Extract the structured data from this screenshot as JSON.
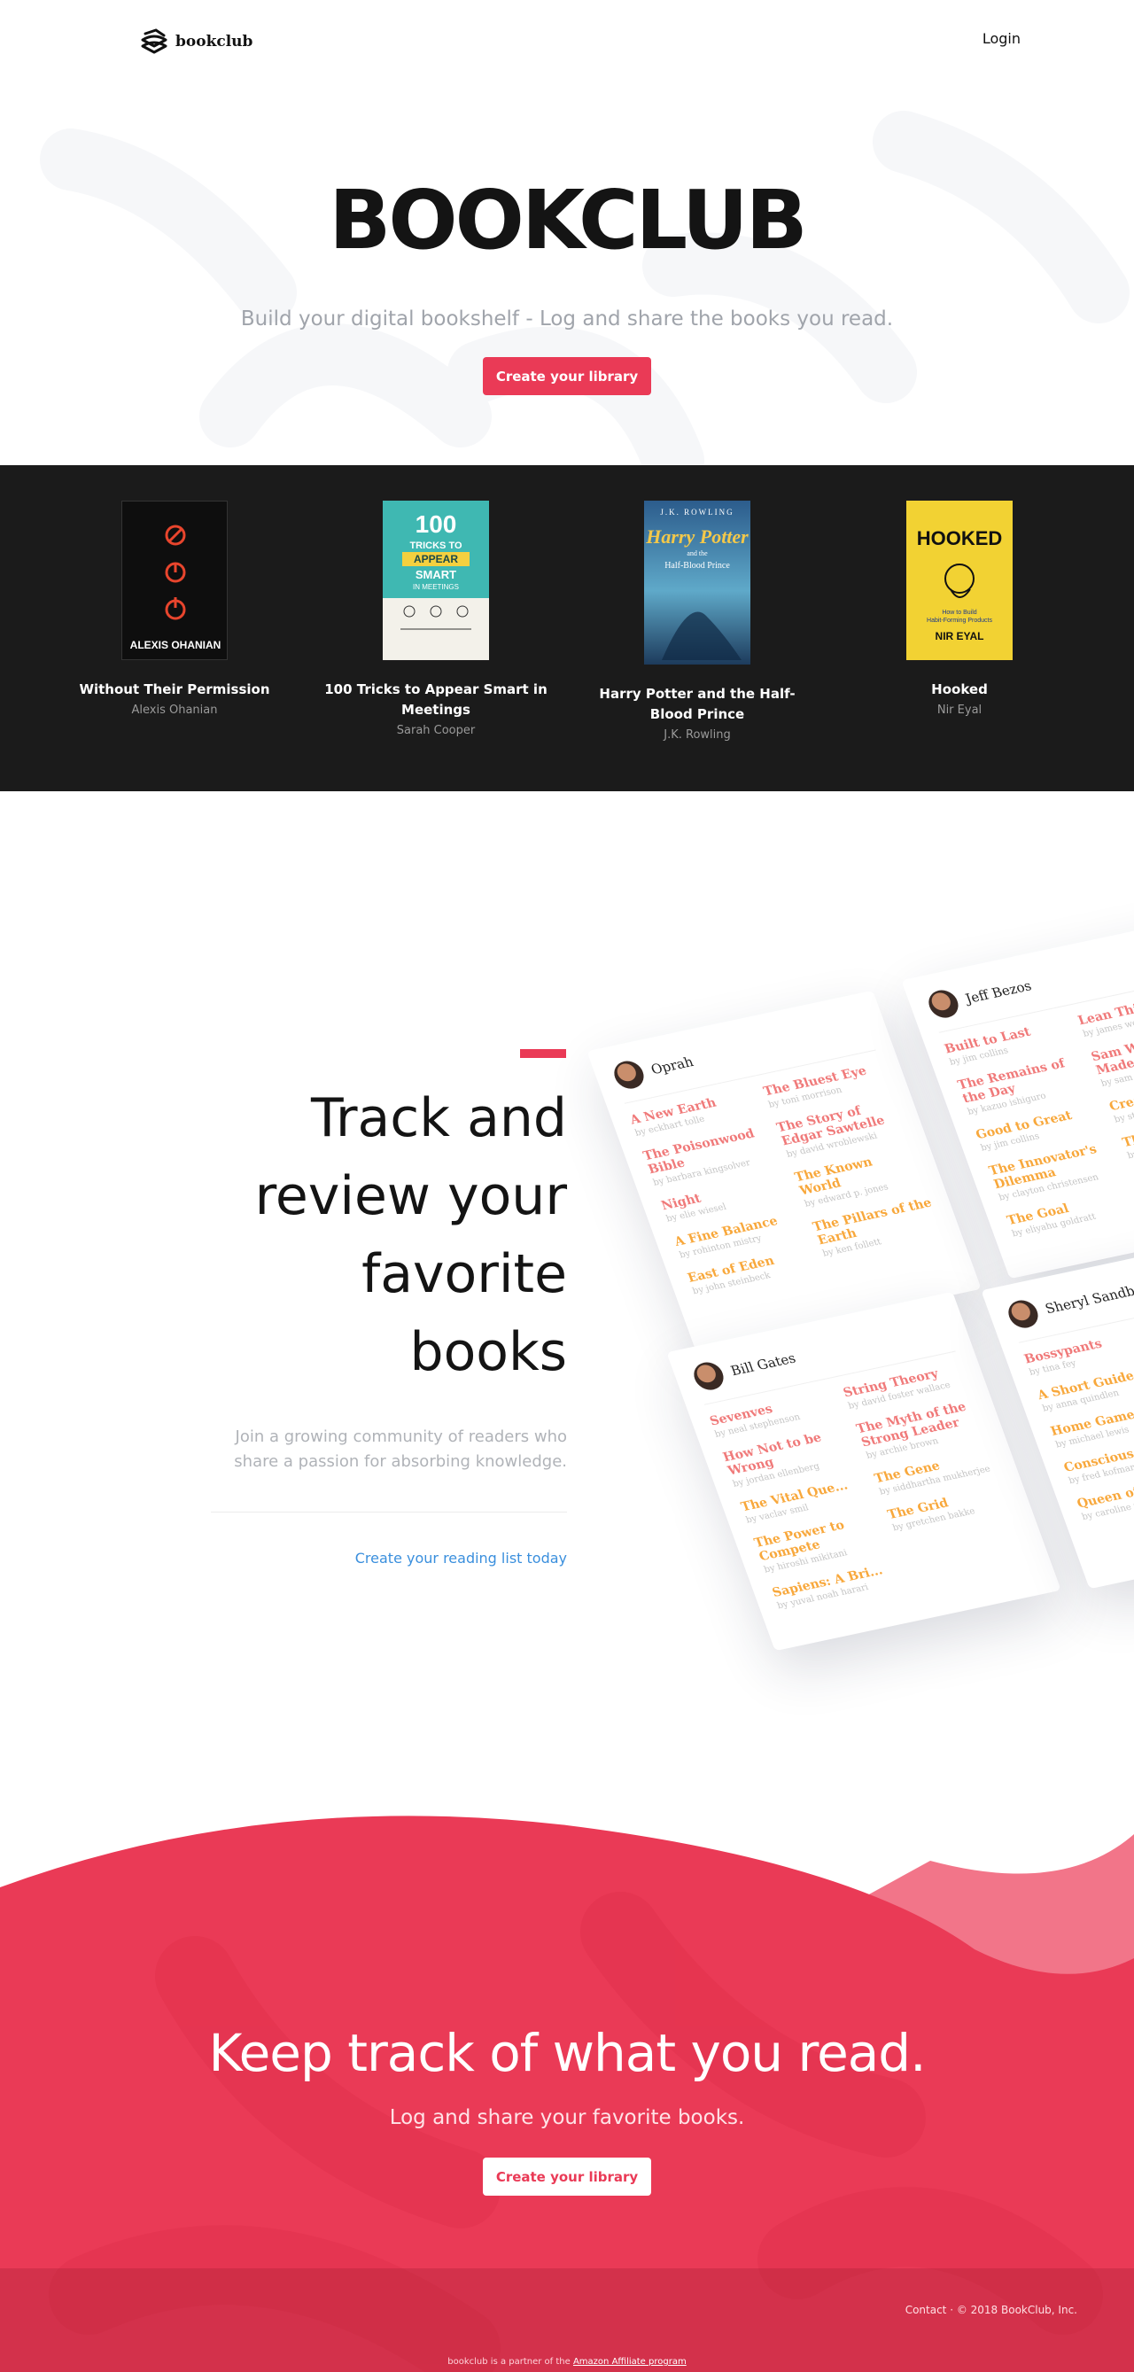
{
  "nav": {
    "brand": "bookclub",
    "login": "Login"
  },
  "hero": {
    "title": "BOOKCLUB",
    "subtitle": "Build your digital bookshelf - Log and share the books you read.",
    "cta": "Create your library"
  },
  "books": [
    {
      "title": "Without Their Permission",
      "author": "Alexis Ohanian",
      "cover_text": "ALEXIS OHANIAN"
    },
    {
      "title": "100 Tricks to Appear Smart in Meetings",
      "author": "Sarah Cooper",
      "cover_text": "100 TRICKS TO APPEAR SMART IN MEETINGS"
    },
    {
      "title": "Harry Potter and the Half-Blood Prince",
      "author": "J.K. Rowling",
      "cover_text": "J.K. ROWLING"
    },
    {
      "title": "Hooked",
      "author": "Nir Eyal",
      "cover_text": "HOOKED"
    }
  ],
  "feature": {
    "title": "Track and review your favorite books",
    "subtitle": "Join a growing community of readers who share a passion for absorbing knowledge.",
    "link": "Create your reading list today"
  },
  "cards": [
    {
      "name": "Oprah",
      "left": [
        [
          "A New Earth",
          "by eckhart tolle"
        ],
        [
          "The Poisonwood Bible",
          "by barbara kingsolver"
        ],
        [
          "Night",
          "by elie wiesel"
        ],
        [
          "A Fine Balance",
          "by rohinton mistry"
        ],
        [
          "East of Eden",
          "by john steinbeck"
        ]
      ],
      "right": [
        [
          "The Bluest Eye",
          "by toni morrison"
        ],
        [
          "The Story of Edgar Sawtelle",
          "by david wroblewski"
        ],
        [
          "The Known World",
          "by edward p. jones"
        ],
        [
          "The Pillars of the Earth",
          "by ken follett"
        ]
      ]
    },
    {
      "name": "Jeff Bezos",
      "left": [
        [
          "Built to Last",
          "by jim collins"
        ],
        [
          "The Remains of the Day",
          "by kazuo ishiguro"
        ],
        [
          "Good to Great",
          "by jim collins"
        ],
        [
          "The Innovator's Dilemma",
          "by clayton christensen"
        ],
        [
          "The Goal",
          "by eliyahu goldratt"
        ]
      ],
      "right": [
        [
          "Lean Thinking",
          "by james womack"
        ],
        [
          "Sam Walton: Made in America",
          "by sam walton"
        ],
        [
          "Creation",
          "by steve grand"
        ],
        [
          "The Black Swan",
          "by nassim taleb"
        ]
      ]
    },
    {
      "name": "Bill Gates",
      "left": [
        [
          "Sevenves",
          "by neal stephenson"
        ],
        [
          "How Not to be Wrong",
          "by jordan ellenberg"
        ],
        [
          "The Vital Que...",
          "by vaclav smil"
        ],
        [
          "The Power to Compete",
          "by hiroshi mikitani"
        ],
        [
          "Sapiens: A Bri...",
          "by yuval noah harari"
        ]
      ],
      "right": [
        [
          "String Theory",
          "by david foster wallace"
        ],
        [
          "The Myth of the Strong Leader",
          "by archie brown"
        ],
        [
          "The Gene",
          "by siddhartha mukherjee"
        ],
        [
          "The Grid",
          "by gretchen bakke"
        ]
      ]
    },
    {
      "name": "Sheryl Sandberg",
      "left": [
        [
          "Bossypants",
          "by tina fey"
        ],
        [
          "A Short Guide to a Happy Life",
          "by anna quindlen"
        ],
        [
          "Home Game",
          "by michael lewis"
        ],
        [
          "Conscious Business",
          "by fred kofman"
        ],
        [
          "Queen of Fa...",
          "by caroline weber"
        ]
      ],
      "right": []
    }
  ],
  "cta": {
    "title": "Keep track of what you read.",
    "subtitle": "Log and share your favorite books.",
    "button": "Create your library"
  },
  "footer": {
    "right": "Contact · © 2018 BookClub, Inc.",
    "bottom_prefix": "bookclub is a partner of the ",
    "bottom_link": "Amazon Affiliate program"
  },
  "colors": {
    "accent": "#ea3a56",
    "dark": "#1b1b1b",
    "link": "#3a8fdd"
  }
}
